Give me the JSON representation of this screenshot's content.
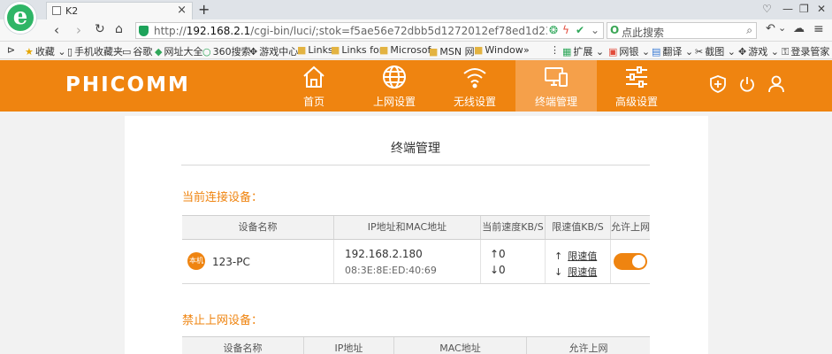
{
  "browser": {
    "tab_title": "K2",
    "url_prefix": "http://",
    "url_host": "192.168.2.1",
    "url_rest": "/cgi-bin/luci/;stok=f5ae56e72dbb5d1272012ef78ed1d23e/admin/devi",
    "search_placeholder": "点此搜索"
  },
  "bookmarks": [
    {
      "icon": "star",
      "label": "收藏"
    },
    {
      "icon": "phone",
      "label": "手机收藏夹"
    },
    {
      "icon": "doc",
      "label": "谷歌"
    },
    {
      "icon": "shield",
      "label": "网址大全"
    },
    {
      "icon": "circle",
      "label": "360搜索"
    },
    {
      "icon": "gamepad",
      "label": "游戏中心"
    },
    {
      "icon": "folder",
      "label": "Links"
    },
    {
      "icon": "folder",
      "label": "Links for"
    },
    {
      "icon": "folder",
      "label": "Microsof"
    },
    {
      "icon": "folder",
      "label": "MSN 网"
    },
    {
      "icon": "folder",
      "label": "Window"
    }
  ],
  "bookmark_tools": [
    {
      "label": "扩展"
    },
    {
      "label": "网银"
    },
    {
      "label": "翻译"
    },
    {
      "label": "截图"
    },
    {
      "label": "游戏"
    },
    {
      "label": "登录管家"
    }
  ],
  "router": {
    "brand": "PHICOMM",
    "nav": [
      {
        "label": "首页",
        "icon": "home"
      },
      {
        "label": "上网设置",
        "icon": "globe"
      },
      {
        "label": "无线设置",
        "icon": "wifi"
      },
      {
        "label": "终端管理",
        "icon": "devices",
        "active": true
      },
      {
        "label": "高级设置",
        "icon": "sliders"
      }
    ]
  },
  "content": {
    "page_title": "终端管理",
    "connected_section": "当前连接设备：",
    "connected_headers": [
      "设备名称",
      "IP地址和MAC地址",
      "当前速度KB/S",
      "限速值KB/S",
      "允许上网"
    ],
    "devices": [
      {
        "badge": "本机",
        "name": "123-PC",
        "ip": "192.168.2.180",
        "mac": "08:3E:8E:ED:40:69",
        "up_speed": "↑0",
        "down_speed": "↓0",
        "up_limit_arrow": "↑",
        "up_limit": "限速值",
        "down_limit_arrow": "↓",
        "down_limit": "限速值",
        "allow_internet": true
      }
    ],
    "blocked_section": "禁止上网设备：",
    "blocked_headers": [
      "设备名称",
      "IP地址",
      "MAC地址",
      "允许上网"
    ]
  }
}
